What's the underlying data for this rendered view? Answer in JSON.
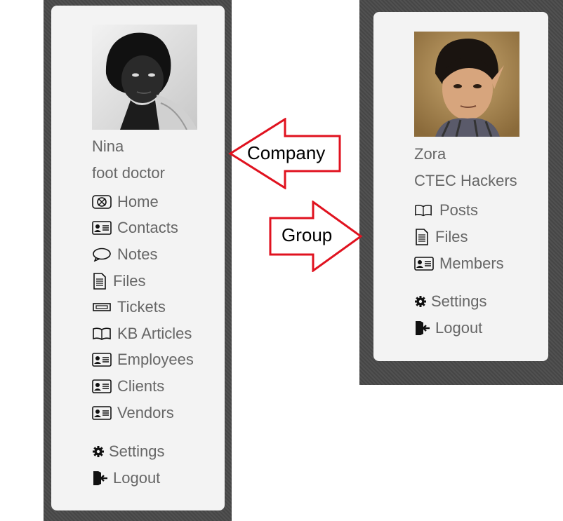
{
  "company": {
    "name": "Nina",
    "subtitle": "foot doctor",
    "avatar": "portrait-photo-nina",
    "menu": [
      {
        "label": "Home",
        "icon": "home-icon"
      },
      {
        "label": "Contacts",
        "icon": "id-card-icon"
      },
      {
        "label": "Notes",
        "icon": "speech-bubble-icon"
      },
      {
        "label": "Files",
        "icon": "file-icon"
      },
      {
        "label": "Tickets",
        "icon": "ticket-icon"
      },
      {
        "label": "KB Articles",
        "icon": "book-icon"
      },
      {
        "label": "Employees",
        "icon": "id-card-icon"
      },
      {
        "label": "Clients",
        "icon": "id-card-icon"
      },
      {
        "label": "Vendors",
        "icon": "id-card-icon"
      }
    ],
    "footer": [
      {
        "label": "Settings",
        "icon": "gear-icon"
      },
      {
        "label": "Logout",
        "icon": "logout-icon"
      }
    ]
  },
  "group": {
    "name": "Zora",
    "subtitle": "CTEC Hackers",
    "avatar": "portrait-illustration-zora",
    "menu": [
      {
        "label": "Posts",
        "icon": "book-icon"
      },
      {
        "label": "Files",
        "icon": "file-icon"
      },
      {
        "label": "Members",
        "icon": "id-card-icon"
      }
    ],
    "footer": [
      {
        "label": "Settings",
        "icon": "gear-icon"
      },
      {
        "label": "Logout",
        "icon": "logout-icon"
      }
    ]
  },
  "annotations": {
    "company_label": "Company",
    "group_label": "Group",
    "arrow_color": "#e0121f"
  }
}
